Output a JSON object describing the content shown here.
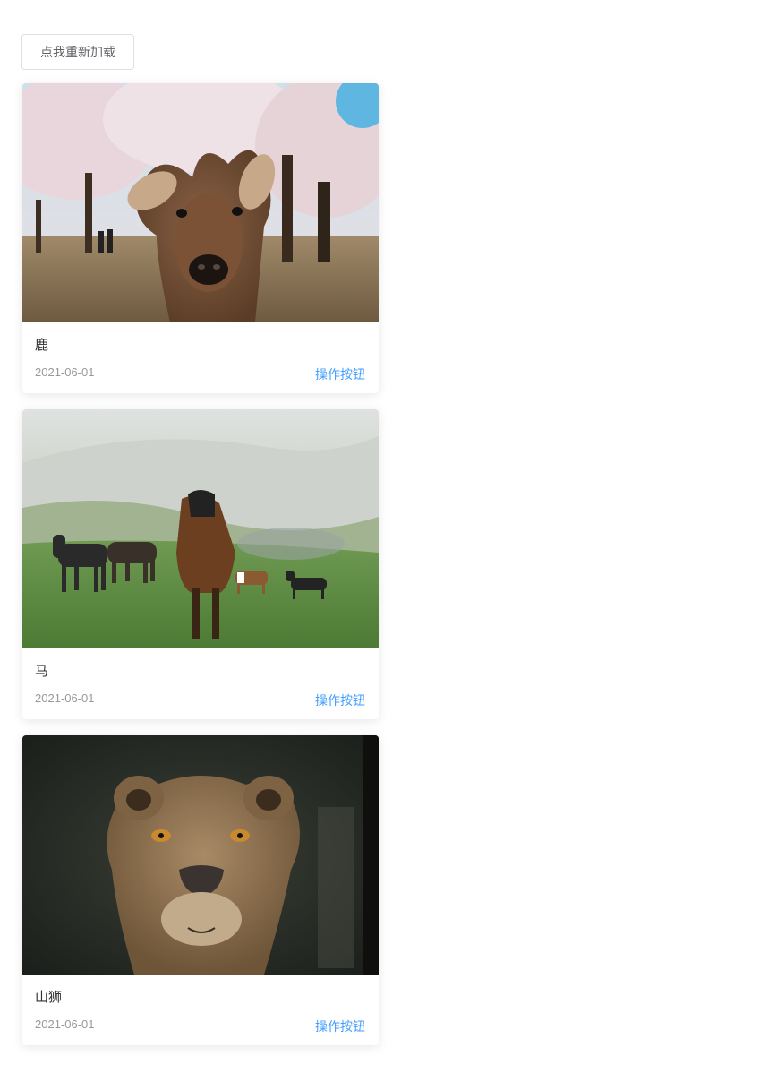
{
  "reload_button": {
    "label": "点我重新加载"
  },
  "cards": [
    {
      "title": "鹿",
      "date": "2021-06-01",
      "action_label": "操作按钮",
      "image": "deer-photo"
    },
    {
      "title": "马",
      "date": "2021-06-01",
      "action_label": "操作按钮",
      "image": "horses-photo"
    },
    {
      "title": "山狮",
      "date": "2021-06-01",
      "action_label": "操作按钮",
      "image": "mountain-lion-photo"
    }
  ],
  "colors": {
    "action": "#409eff",
    "date": "#999999",
    "title": "#303133",
    "button_border": "#dcdfe6"
  }
}
